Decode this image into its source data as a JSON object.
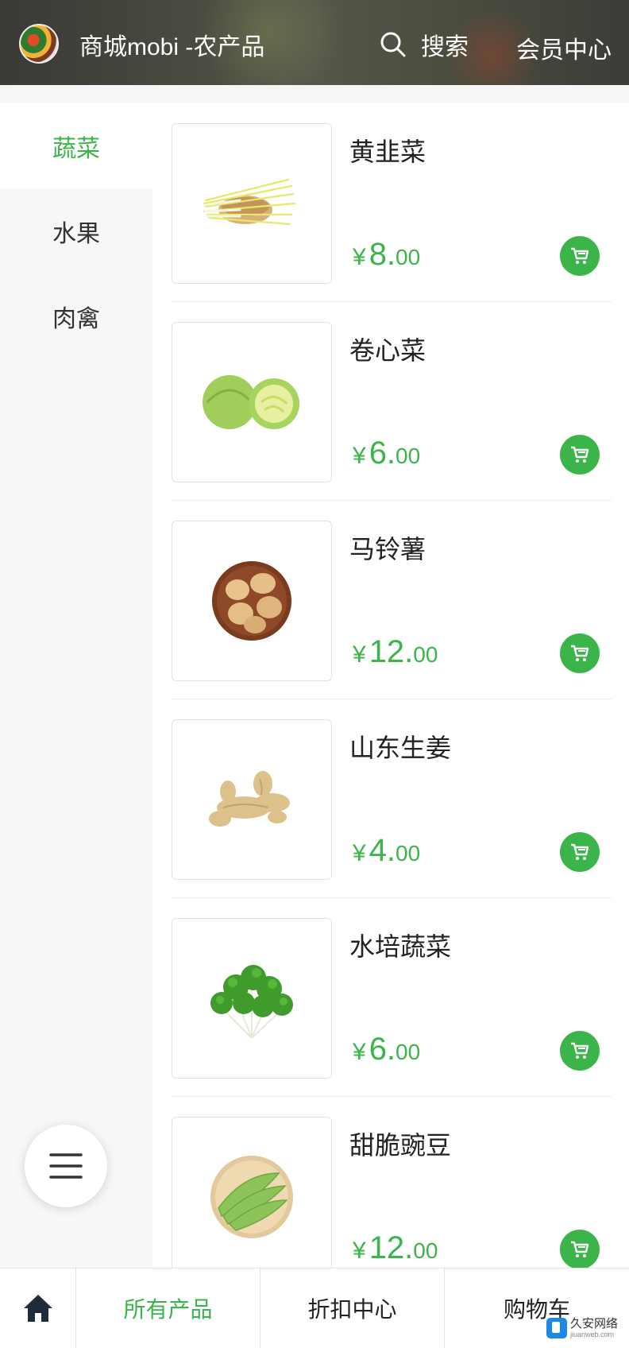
{
  "header": {
    "title": "商城mobi -农产品",
    "search_label": "搜索",
    "member_label": "会员中心"
  },
  "sidebar": {
    "items": [
      {
        "label": "蔬菜",
        "active": true
      },
      {
        "label": "水果",
        "active": false
      },
      {
        "label": "肉禽",
        "active": false
      }
    ]
  },
  "products": [
    {
      "name": "黄韭菜",
      "currency": "¥",
      "price_int": "8.",
      "price_dec": "00",
      "image": "chive-image"
    },
    {
      "name": "卷心菜",
      "currency": "¥",
      "price_int": "6.",
      "price_dec": "00",
      "image": "cabbage-image"
    },
    {
      "name": "马铃薯",
      "currency": "¥",
      "price_int": "12.",
      "price_dec": "00",
      "image": "potato-image"
    },
    {
      "name": "山东生姜",
      "currency": "¥",
      "price_int": "4.",
      "price_dec": "00",
      "image": "ginger-image"
    },
    {
      "name": "水培蔬菜",
      "currency": "¥",
      "price_int": "6.",
      "price_dec": "00",
      "image": "coriander-image"
    },
    {
      "name": "甜脆豌豆",
      "currency": "¥",
      "price_int": "12.",
      "price_dec": "00",
      "image": "peas-image"
    }
  ],
  "bottom_nav": {
    "home_icon": "home-icon",
    "tabs": [
      {
        "label": "所有产品",
        "active": true
      },
      {
        "label": "折扣中心",
        "active": false
      },
      {
        "label": "购物车",
        "active": false
      }
    ]
  },
  "watermark": {
    "title": "久安网络",
    "subtitle": "jiuanweb.com"
  },
  "colors": {
    "accent": "#3bb54a",
    "sidebar_bg": "#f7f7f7"
  }
}
